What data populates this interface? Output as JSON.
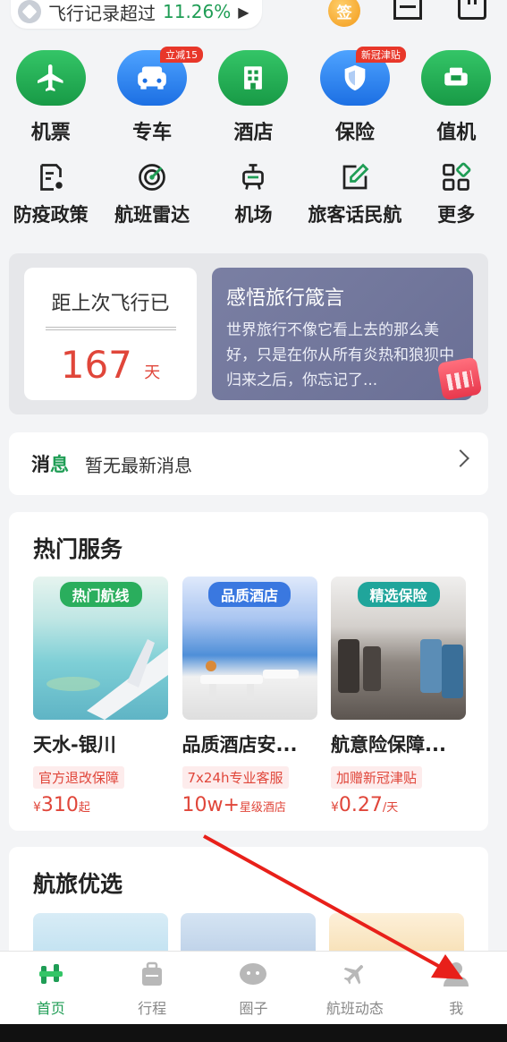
{
  "topbar": {
    "record_text": "飞行记录超过",
    "record_percent": "11.26%",
    "arrow": "▶",
    "sign_label": "签"
  },
  "main_icons": [
    {
      "label": "机票",
      "icon": "plane-icon",
      "color": "green"
    },
    {
      "label": "专车",
      "icon": "car-icon",
      "color": "blue",
      "badge": "立减15"
    },
    {
      "label": "酒店",
      "icon": "hotel-building-icon",
      "color": "green"
    },
    {
      "label": "保险",
      "icon": "shield-icon",
      "color": "blue",
      "badge": "新冠津贴"
    },
    {
      "label": "值机",
      "icon": "seat-icon",
      "color": "green"
    }
  ],
  "sub_icons": [
    {
      "label": "防疫政策",
      "icon": "policy-doc-icon"
    },
    {
      "label": "航班雷达",
      "icon": "radar-icon"
    },
    {
      "label": "机场",
      "icon": "airport-icon"
    },
    {
      "label": "旅客话民航",
      "icon": "edit-icon"
    },
    {
      "label": "更多",
      "icon": "more-grid-icon"
    }
  ],
  "flight_card": {
    "since_title": "距上次飞行已",
    "days": "167",
    "days_unit": "天",
    "quote_title": "感悟旅行箴言",
    "quote_body": "世界旅行不像它看上去的那么美好，只是在你从所有炎热和狼狈中归来之后，你忘记了..."
  },
  "message": {
    "key_a": "消",
    "key_b": "息",
    "value": "暂无最新消息"
  },
  "hot_services": {
    "title": "热门服务",
    "cards": [
      {
        "tag": "热门航线",
        "name": "天水-银川",
        "perk": "官方退改保障",
        "currency": "¥",
        "price": "310",
        "suffix": "起"
      },
      {
        "tag": "品质酒店",
        "name": "品质酒店安...",
        "perk": "7x24h专业客服",
        "currency": "",
        "price": "10w+",
        "suffix": "星级酒店"
      },
      {
        "tag": "精选保险",
        "name": "航意险保障...",
        "perk": "加赠新冠津贴",
        "currency": "¥",
        "price": "0.27",
        "suffix": "/天"
      }
    ]
  },
  "picks": {
    "title": "航旅优选"
  },
  "bottom_nav": [
    {
      "label": "首页",
      "icon": "home-icon",
      "active": true
    },
    {
      "label": "行程",
      "icon": "suitcase-icon",
      "active": false
    },
    {
      "label": "圈子",
      "icon": "circle-chat-icon",
      "active": false
    },
    {
      "label": "航班动态",
      "icon": "plane-status-icon",
      "active": false
    },
    {
      "label": "我",
      "icon": "user-icon",
      "active": false
    }
  ],
  "colors": {
    "brand_green": "#1f9d55",
    "accent_red": "#e0463a",
    "blue": "#1c6fe3"
  }
}
